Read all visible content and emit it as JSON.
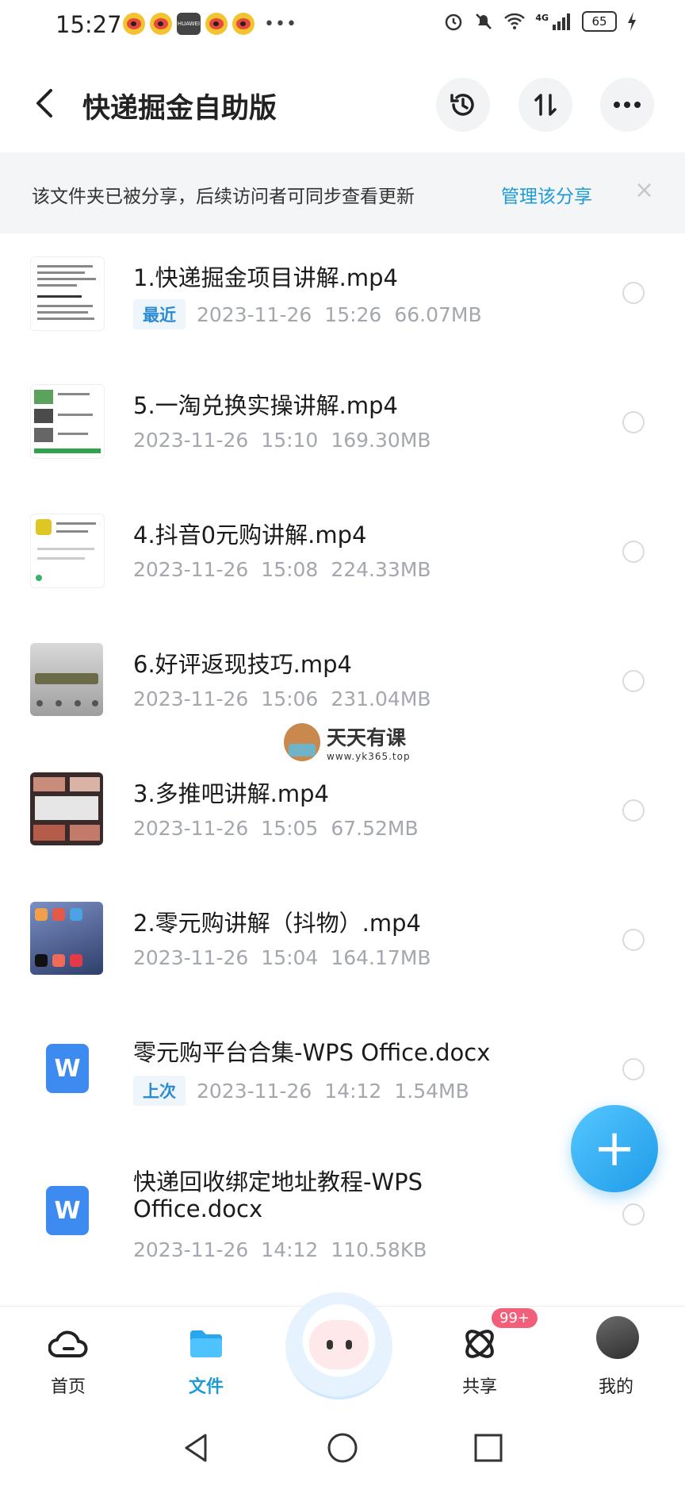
{
  "status_bar": {
    "time": "15:27",
    "network": "4G",
    "battery": "65"
  },
  "header": {
    "title": "快递掘金自助版"
  },
  "banner": {
    "message": "该文件夹已被分享，后续访问者可同步查看更新",
    "link": "管理该分享",
    "close": "×"
  },
  "files": [
    {
      "name": "1.快递掘金项目讲解.mp4",
      "tag": "最近",
      "date": "2023-11-26",
      "time": "15:26",
      "size": "66.07MB",
      "thumb": "doc-preview"
    },
    {
      "name": "5.一淘兑换实操讲解.mp4",
      "tag": "",
      "date": "2023-11-26",
      "time": "15:10",
      "size": "169.30MB",
      "thumb": "app-screens"
    },
    {
      "name": "4.抖音0元购讲解.mp4",
      "tag": "",
      "date": "2023-11-26",
      "time": "15:08",
      "size": "224.33MB",
      "thumb": "phone-screen"
    },
    {
      "name": "6.好评返现技巧.mp4",
      "tag": "",
      "date": "2023-11-26",
      "time": "15:06",
      "size": "231.04MB",
      "thumb": "gray-screen"
    },
    {
      "name": "3.多推吧讲解.mp4",
      "tag": "",
      "date": "2023-11-26",
      "time": "15:05",
      "size": "67.52MB",
      "thumb": "money-cards"
    },
    {
      "name": "2.零元购讲解（抖物）.mp4",
      "tag": "",
      "date": "2023-11-26",
      "time": "15:04",
      "size": "164.17MB",
      "thumb": "home-screen"
    },
    {
      "name": "零元购平台合集-WPS Office.docx",
      "tag": "上次",
      "date": "2023-11-26",
      "time": "14:12",
      "size": "1.54MB",
      "thumb": "wps-icon"
    },
    {
      "name_line1": "快递回收绑定地址教程-WPS",
      "name_line2": "Office.docx",
      "tag": "",
      "date": "2023-11-26",
      "time": "14:12",
      "size": "110.58KB",
      "thumb": "wps-icon"
    }
  ],
  "watermark": {
    "title": "天天有课",
    "url": "www.yk365.top"
  },
  "fab": {
    "label": "+"
  },
  "bottom_nav": {
    "home": "首页",
    "files": "文件",
    "share": "共享",
    "share_badge": "99+",
    "mine": "我的"
  },
  "wps_letter": "W",
  "colors": {
    "accent": "#1e9bd7",
    "badge": "#f25f7a",
    "wps": "#3d8bf0"
  }
}
